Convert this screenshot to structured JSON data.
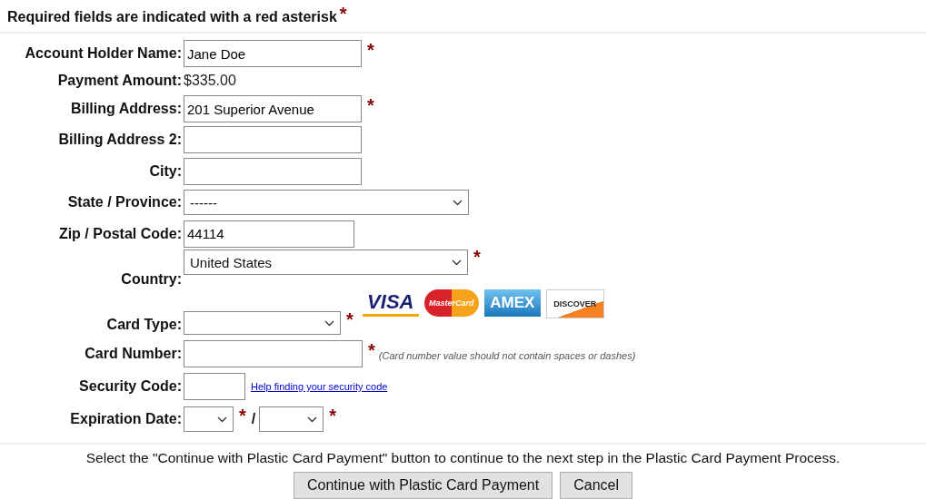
{
  "heading": {
    "text": "Required fields are indicated with a red asterisk",
    "mark": "*"
  },
  "fields": [
    {
      "kind": "input",
      "label": "Account Holder Name:",
      "value": "Jane Doe",
      "mark": "*"
    },
    {
      "kind": "static",
      "label": "Payment Amount:",
      "value": "$335.00"
    },
    {
      "kind": "input",
      "label": "Billing Address:",
      "value": "201 Superior Avenue",
      "mark": "*"
    },
    {
      "kind": "input",
      "label": "Billing Address 2:"
    },
    {
      "kind": "input",
      "label": "City:"
    },
    {
      "kind": "select",
      "label": "State / Province:",
      "value": "------"
    },
    {
      "kind": "input",
      "label": "Zip / Postal Code:",
      "value": "44114"
    },
    {
      "kind": "select",
      "label": "Country:",
      "value": "United States",
      "mark": "*"
    },
    {
      "kind": "select",
      "label": "Card Type:",
      "mark": "*",
      "logos": [
        "VISA",
        "MasterCard",
        "AMEX",
        "DISCOVER"
      ]
    },
    {
      "kind": "input",
      "label": "Card Number:",
      "mark": "*",
      "hint": "(Card number value should not contain spaces or dashes)"
    },
    {
      "kind": "input",
      "label": "Security Code:",
      "link": "Help finding your security code"
    },
    {
      "kind": "expiry",
      "label": "Expiration Date:",
      "marks": [
        "*",
        "*"
      ],
      "separator": "/"
    }
  ],
  "instruction": "Select the \"Continue with Plastic Card Payment\" button to continue to the next step in the Plastic Card Payment Process.",
  "buttons": [
    "Continue with Plastic Card Payment",
    "Cancel"
  ]
}
